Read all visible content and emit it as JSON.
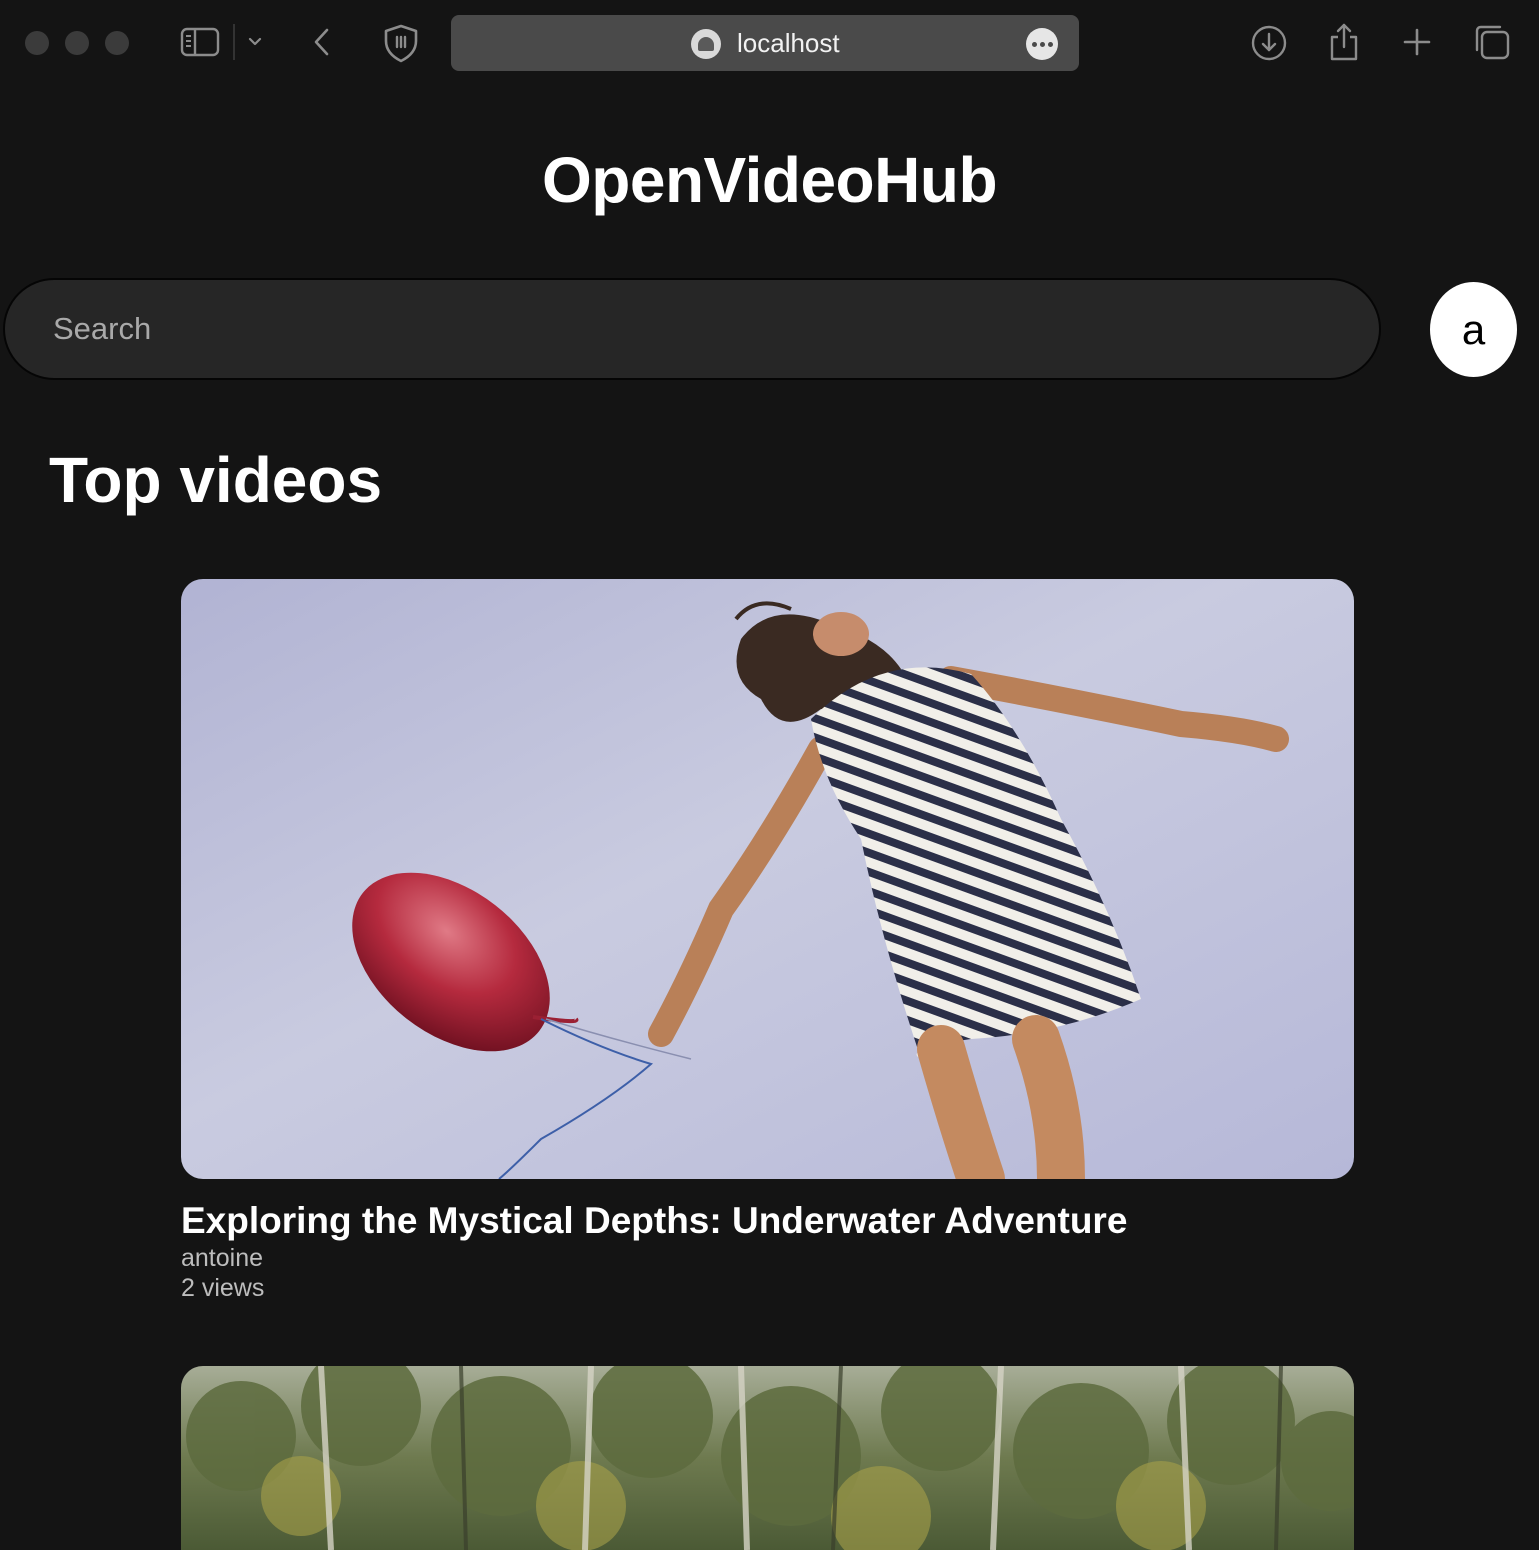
{
  "browser": {
    "address": "localhost",
    "icons": {
      "sidebar": "sidebar-toggle-icon",
      "chevron": "chevron-down-icon",
      "back": "back-arrow-icon",
      "shield": "privacy-shield-icon",
      "site": "site-favicon-icon",
      "more": "more-options-icon",
      "download": "download-icon",
      "share": "share-icon",
      "new_tab": "new-tab-plus-icon",
      "tabs": "tab-overview-icon"
    }
  },
  "header": {
    "title": "OpenVideoHub"
  },
  "search": {
    "placeholder": "Search"
  },
  "user": {
    "avatar_letter": "a"
  },
  "main": {
    "section_title": "Top videos",
    "videos": [
      {
        "title": "Exploring the Mystical Depths: Underwater Adventure",
        "author": "antoine",
        "views": "2 views"
      }
    ]
  },
  "colors": {
    "background": "#141414",
    "search_bg": "#262626",
    "address_bar": "#4a4a4a",
    "text": "#ffffff",
    "meta_text": "#bdbdbd"
  }
}
